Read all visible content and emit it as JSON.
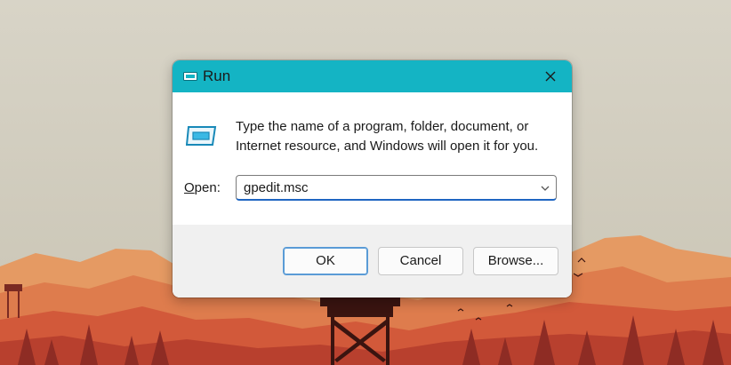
{
  "dialog": {
    "title": "Run",
    "description": "Type the name of a program, folder, document, or Internet resource, and Windows will open it for you.",
    "open_label_underlined": "O",
    "open_label_rest": "pen:",
    "open_value": "gpedit.msc",
    "buttons": {
      "ok": "OK",
      "cancel": "Cancel",
      "browse": "Browse..."
    }
  },
  "colors": {
    "titlebar": "#14b4c4",
    "focus_border": "#1f66c2",
    "footer": "#f0f0f0"
  },
  "icons": {
    "title": "run-app-icon",
    "body": "run-app-icon",
    "close": "close-icon",
    "dropdown": "chevron-down-icon"
  }
}
